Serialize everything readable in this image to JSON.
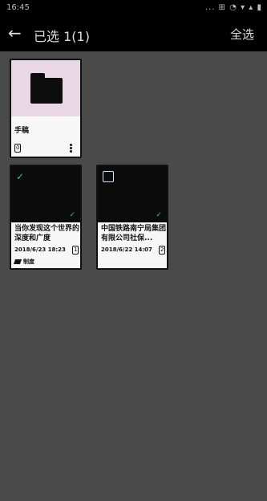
{
  "status_bar": {
    "time": "16:45",
    "icons": "... ⊞ ◔ ▾ ▴ ▮"
  },
  "app_bar": {
    "title": "已选 1(1)",
    "right_action": "全选"
  },
  "items": [
    {
      "type": "folder",
      "name": "手稿",
      "count": "0"
    },
    {
      "type": "document",
      "selected": true,
      "name": "当你发现这个世界的深度和广度",
      "date": "2018/6/23 18:23",
      "pages": "1",
      "tag": "制度"
    },
    {
      "type": "document",
      "selected": false,
      "name": "中国铁路南宁局集团有限公司社保...",
      "date": "2018/6/22 14:07",
      "pages": "2"
    }
  ]
}
